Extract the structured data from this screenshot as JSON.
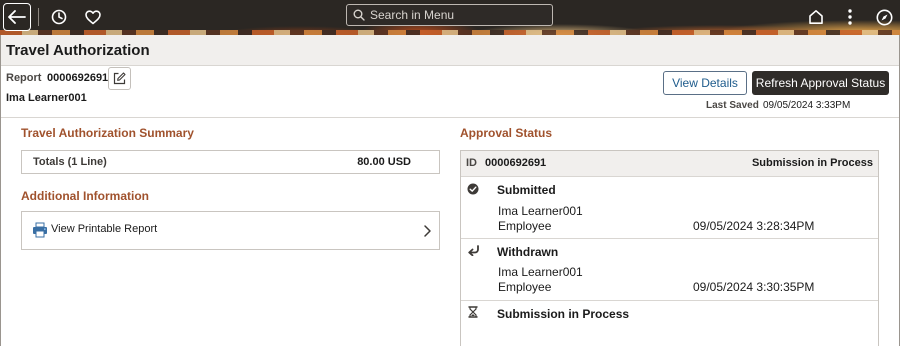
{
  "nav": {
    "search_placeholder": "Search in Menu",
    "icons": [
      "back-arrow-icon",
      "history-icon",
      "heart-icon",
      "search-icon",
      "home-icon",
      "more-icon",
      "navigator-icon"
    ]
  },
  "page": {
    "title": "Travel Authorization"
  },
  "report": {
    "label": "Report",
    "id": "0000692691",
    "employee": "Ima Learner001",
    "view_details": "View Details",
    "refresh": "Refresh Approval Status",
    "last_saved_label": "Last Saved",
    "last_saved_value": "09/05/2024  3:33PM"
  },
  "summary": {
    "heading": "Travel Authorization Summary",
    "totals_label": "Totals (1 Line)",
    "totals_value": "80.00 USD"
  },
  "additional": {
    "heading": "Additional Information",
    "printable_label": "View Printable Report"
  },
  "approval": {
    "heading": "Approval Status",
    "id_label": "ID",
    "id_value": "0000692691",
    "status": "Submission in Process",
    "steps": [
      {
        "title": "Submitted",
        "icon": "check-circle-icon",
        "name": "Ima Learner001",
        "role": "Employee",
        "date": "09/05/2024  3:28:34PM"
      },
      {
        "title": "Withdrawn",
        "icon": "withdraw-arrow-icon",
        "name": "Ima Learner001",
        "role": "Employee",
        "date": "09/05/2024  3:30:35PM"
      },
      {
        "title": "Submission in Process",
        "icon": "hourglass-icon"
      }
    ]
  },
  "colors": {
    "accent_heading": "#a0522d",
    "nav_bar": "#2b2723",
    "primary_button": "#2f2c29",
    "link_blue": "#1e5b8c"
  }
}
